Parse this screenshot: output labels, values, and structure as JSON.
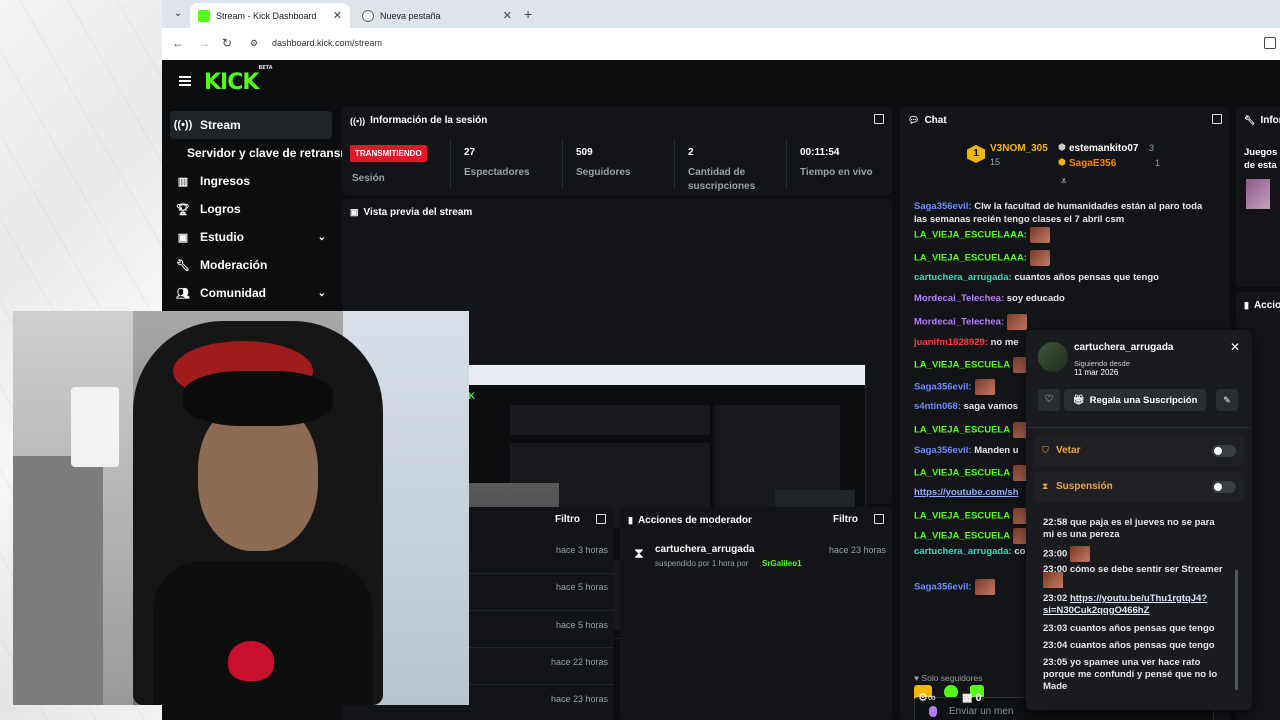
{
  "browser": {
    "tab_active_title": "Stream - Kick Dashboard",
    "tab_inactive_title": "Nueva pestaña",
    "url": "dashboard.kick.com/stream"
  },
  "brand": {
    "logo": "KICK",
    "beta": "BETA",
    "accent": "#53fc18"
  },
  "sidebar": {
    "items": [
      {
        "label": "Stream",
        "icon": "broadcast-icon"
      },
      {
        "label": "Ingresos",
        "icon": "chart-icon"
      },
      {
        "label": "Logros",
        "icon": "trophy-icon"
      },
      {
        "label": "Estudio",
        "icon": "studio-icon"
      },
      {
        "label": "Moderación",
        "icon": "wrench-icon"
      },
      {
        "label": "Comunidad",
        "icon": "community-icon"
      }
    ],
    "sub_item": "Servidor y clave de retransmisión"
  },
  "session": {
    "title": "Información de la sesión",
    "status": "TRANSMITIENDO",
    "status_label": "Sesión",
    "viewers": "27",
    "viewers_label": "Espectadores",
    "followers": "509",
    "followers_label": "Seguidores",
    "subs": "2",
    "subs_label": "Cantidad de suscripciones",
    "uptime": "00:11:54",
    "uptime_label": "Tiempo en vivo"
  },
  "preview": {
    "title": "Vista previa del stream"
  },
  "events_panel": {
    "filter": "Filtro",
    "times": [
      "hace 3 horas",
      "hace 5 horas",
      "hace 5 horas",
      "hace 22 horas",
      "hace 23 horas"
    ]
  },
  "mod_actions": {
    "title": "Acciones de moderador",
    "filter": "Filtro",
    "entry_user": "cartuchera_arrugada",
    "entry_text": "suspendido por 1 hora por",
    "entry_mod": "SrGalileo1",
    "entry_time": "hace 23 horas"
  },
  "chat": {
    "title": "Chat",
    "leaderboard": [
      {
        "rank": "1",
        "name": "V3NOM_305",
        "count": "15"
      },
      {
        "rank": "",
        "name": "estemankito07",
        "count": "3"
      },
      {
        "rank": "",
        "name": "SagaE356",
        "count": "1"
      }
    ],
    "messages": [
      {
        "user": "Saga356evil:",
        "text": " Clw la facultad de humanidades están al paro toda las semanas recién tengo clases el 7 abril csm",
        "color": "u-blue"
      },
      {
        "user": "LA_VIEJA_ESCUELAAA:",
        "text": "",
        "color": "u-green"
      },
      {
        "user": "LA_VIEJA_ESCUELAAA:",
        "text": "",
        "color": "u-green"
      },
      {
        "user": "cartuchera_arrugada:",
        "text": " cuantos años pensas que tengo",
        "color": "u-teal"
      },
      {
        "user": "Mordecai_Telechea:",
        "text": " soy educado",
        "color": "u-purple"
      },
      {
        "user": "Mordecai_Telechea:",
        "text": "",
        "color": "u-purple"
      },
      {
        "user": "juanifm1828929:",
        "text": " no me",
        "color": "u-red"
      },
      {
        "user": "LA_VIEJA_ESCUELA",
        "text": "",
        "color": "u-green"
      },
      {
        "user": "Saga356evil:",
        "text": "",
        "color": "u-blue"
      },
      {
        "user": "s4ntin068:",
        "text": " saga vamos",
        "color": "u-blue"
      },
      {
        "user": "LA_VIEJA_ESCUELA",
        "text": "",
        "color": "u-green"
      },
      {
        "user": "Saga356evil:",
        "text": " Manden u",
        "color": "u-blue"
      },
      {
        "user": "LA_VIEJA_ESCUELA",
        "text": "",
        "color": "u-green"
      },
      {
        "user": "",
        "text": "https://youtube.com/sh",
        "color": "u-blue"
      },
      {
        "user": "LA_VIEJA_ESCUELA",
        "text": "",
        "color": "u-green"
      },
      {
        "user": "LA_VIEJA_ESCUELA",
        "text": "",
        "color": "u-green"
      },
      {
        "user": "cartuchera_arrugada:",
        "text": " confundí y pensé que n",
        "color": "u-teal"
      },
      {
        "user": "Saga356evil:",
        "text": "",
        "color": "u-blue"
      }
    ],
    "followers_only": "Solo seguidores",
    "input_placeholder": "Enviar un men",
    "footer_count": "0"
  },
  "user_popup": {
    "username": "cartuchera_arrugada",
    "following_label": "Siguiendo desde",
    "following_date": "11 mar 2026",
    "gift_sub": "Regala una Suscripción",
    "ban_label": "Vetar",
    "timeout_label": "Suspensión",
    "log": [
      {
        "time": "22:58",
        "text": "que paja es el jueves no se para mi es una pereza"
      },
      {
        "time": "23:00",
        "text": ""
      },
      {
        "time": "23:00",
        "text": "cómo se debe sentir ser Streamer"
      },
      {
        "time": "23:02",
        "text": "https://youtu.be/uThu1rgtqJ4?si=N30Cuk2qqgO466hZ"
      },
      {
        "time": "23:03",
        "text": "cuantos años pensas que tengo"
      },
      {
        "time": "23:04",
        "text": "cuantos años pensas que tengo"
      },
      {
        "time": "23:05",
        "text": "yo spamee una ver hace rato porque me confundí y pensé que no lo Made"
      }
    ]
  },
  "right_partial": {
    "title1": "Infor",
    "text1": "Juegos",
    "text2": "de esta",
    "title2": "Accio"
  }
}
